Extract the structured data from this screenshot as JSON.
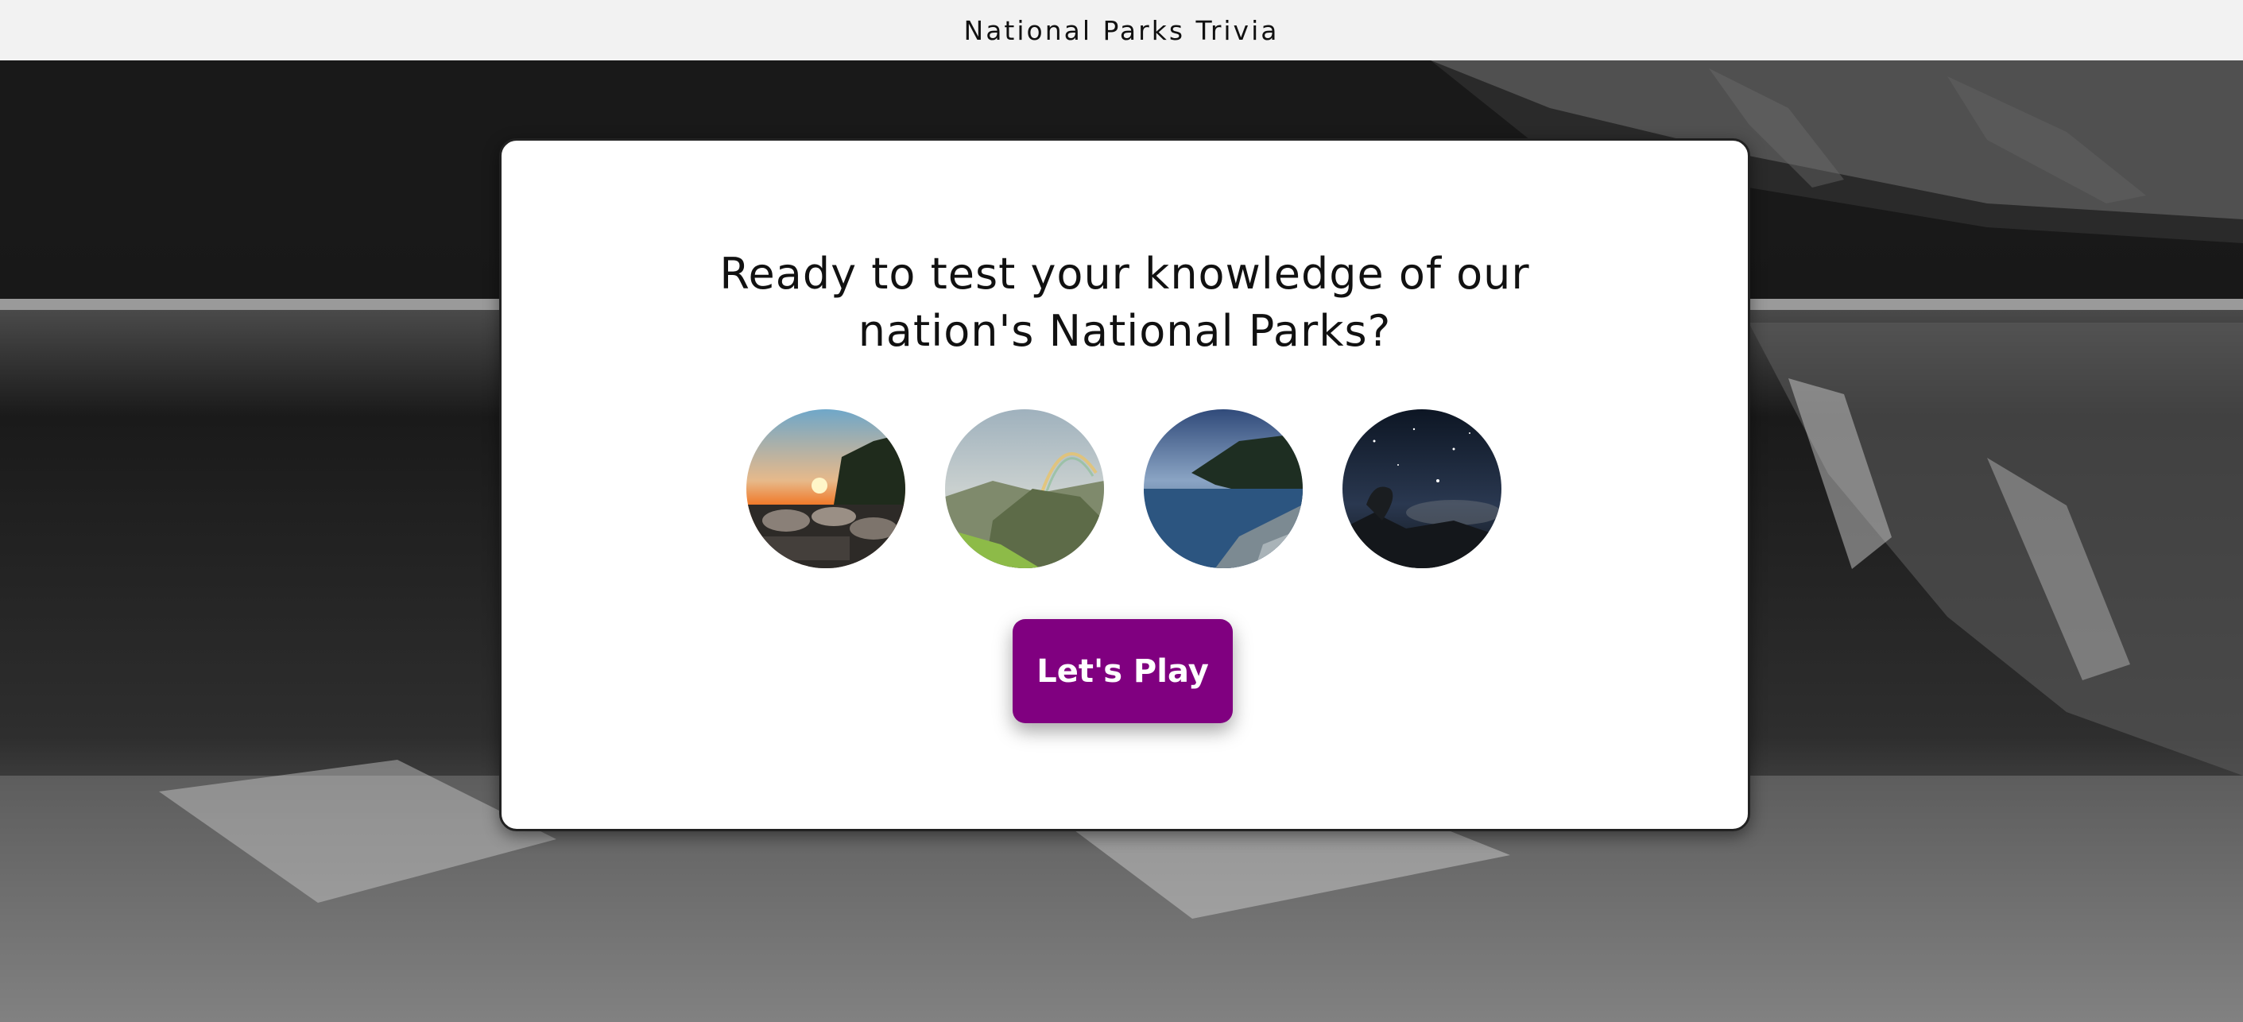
{
  "header": {
    "title": "National Parks Trivia"
  },
  "card": {
    "headline_line1": "Ready to test your knowledge of our",
    "headline_line2": "nation's National Parks?",
    "play_button_label": "Let's Play"
  },
  "photos": [
    {
      "name": "sunset-rocks-photo"
    },
    {
      "name": "rainbow-mountains-photo"
    },
    {
      "name": "lake-shore-photo"
    },
    {
      "name": "night-sky-photo"
    }
  ],
  "colors": {
    "accent": "#800080",
    "header_bg": "#f2f2f2",
    "card_bg": "#ffffff"
  }
}
